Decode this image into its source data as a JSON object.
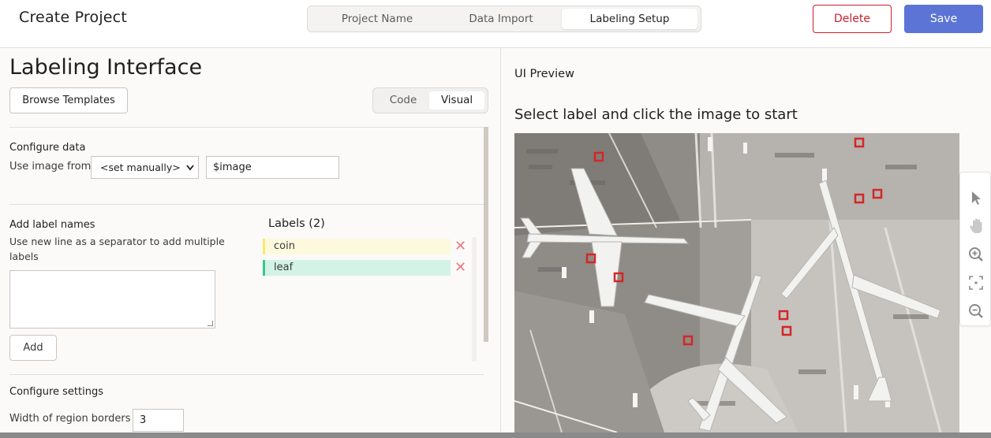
{
  "header": {
    "title": "Create Project",
    "steps": [
      "Project Name",
      "Data Import",
      "Labeling Setup"
    ],
    "active_step": "Labeling Setup",
    "delete_label": "Delete",
    "save_label": "Save"
  },
  "left": {
    "heading": "Labeling Interface",
    "browse_label": "Browse Templates",
    "view_modes": [
      "Code",
      "Visual"
    ],
    "active_view": "Visual",
    "configure_data": {
      "title": "Configure data",
      "use_label": "Use image from",
      "select_value": "<set manually>",
      "input_value": "$image"
    },
    "add_labels": {
      "title": "Add label names",
      "help": "Use new line as a separator to add multiple labels",
      "textarea_value": "",
      "add_button": "Add"
    },
    "labels_panel": {
      "title": "Labels (2)",
      "items": [
        {
          "name": "coin",
          "color": "#fbe86b",
          "bg": "#fdf9dd"
        },
        {
          "name": "leaf",
          "color": "#34c98b",
          "bg": "#d2f3e5"
        }
      ],
      "remove_glyph": "✕"
    },
    "settings": {
      "title": "Configure settings",
      "region_label": "Width of region borders",
      "region_value": "3"
    }
  },
  "preview": {
    "title": "UI Preview",
    "instruction": "Select label and click the image to start",
    "image_icon": "aerial-airport-image",
    "tools": [
      "pointer-icon",
      "hand-icon",
      "zoom-in-icon",
      "fit-icon",
      "zoom-out-icon"
    ]
  },
  "colors": {
    "accent": "#5b74d6",
    "danger": "#c92030",
    "remove": "#ee7a82"
  }
}
